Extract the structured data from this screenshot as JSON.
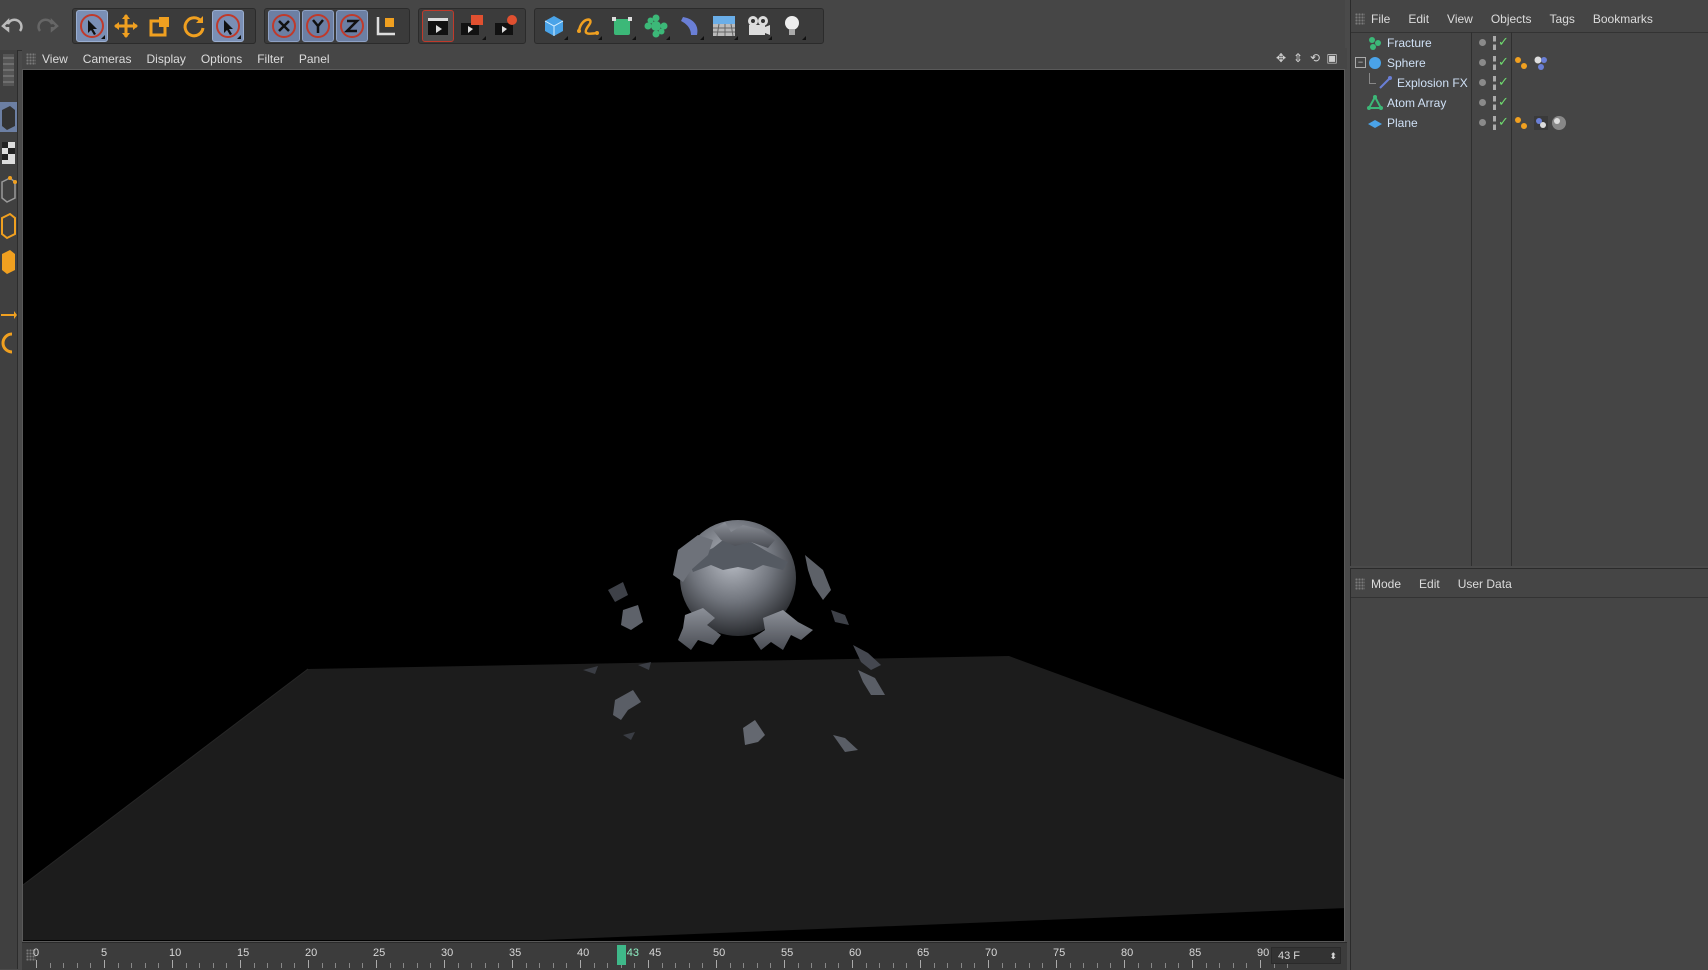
{
  "toolbar": {
    "groups": [
      {
        "name": "history",
        "items": [
          "undo-icon",
          "redo-icon"
        ]
      },
      {
        "name": "tools",
        "items": [
          "live-selection-icon",
          "move-icon",
          "scale-icon",
          "rotate-icon",
          "recent-tool-icon"
        ]
      },
      {
        "name": "axes",
        "items": [
          "x-axis-lock-icon",
          "y-axis-lock-icon",
          "z-axis-lock-icon",
          "coordinate-system-icon"
        ]
      },
      {
        "name": "render",
        "items": [
          "render-view-icon",
          "render-picture-viewer-icon",
          "render-settings-icon"
        ]
      },
      {
        "name": "create",
        "items": [
          "cube-icon",
          "spline-icon",
          "nurbs-icon",
          "array-icon",
          "deformer-icon",
          "environment-icon",
          "camera-icon",
          "light-icon"
        ]
      }
    ],
    "colors": {
      "accent_orange": "#f0a020",
      "active_blue": "#7a8fb5"
    }
  },
  "viewport": {
    "menu": [
      "View",
      "Cameras",
      "Display",
      "Options",
      "Filter",
      "Panel"
    ]
  },
  "timeline": {
    "ticks": [
      "0",
      "5",
      "10",
      "15",
      "20",
      "25",
      "30",
      "35",
      "40",
      "45",
      "50",
      "55",
      "60",
      "65",
      "70",
      "75",
      "80",
      "85",
      "90"
    ],
    "current_frame": "43",
    "frame_field": "43 F"
  },
  "object_manager": {
    "menu": [
      "File",
      "Edit",
      "View",
      "Objects",
      "Tags",
      "Bookmarks"
    ],
    "objects": [
      {
        "name": "Fracture",
        "icon": "fracture-icon",
        "level": 0,
        "tags": []
      },
      {
        "name": "Sphere",
        "icon": "sphere-icon",
        "level": 0,
        "tags": [
          "phong-tag-icon",
          "material-tag-icon"
        ]
      },
      {
        "name": "Explosion FX",
        "icon": "explosion-fx-icon",
        "level": 1,
        "tags": []
      },
      {
        "name": "Atom Array",
        "icon": "atom-array-icon",
        "level": 0,
        "tags": []
      },
      {
        "name": "Plane",
        "icon": "plane-icon",
        "level": 0,
        "tags": [
          "phong-tag-icon",
          "texture-tag-icon",
          "material-sphere-icon"
        ]
      }
    ]
  },
  "attribute_manager": {
    "menu": [
      "Mode",
      "Edit",
      "User Data"
    ]
  }
}
